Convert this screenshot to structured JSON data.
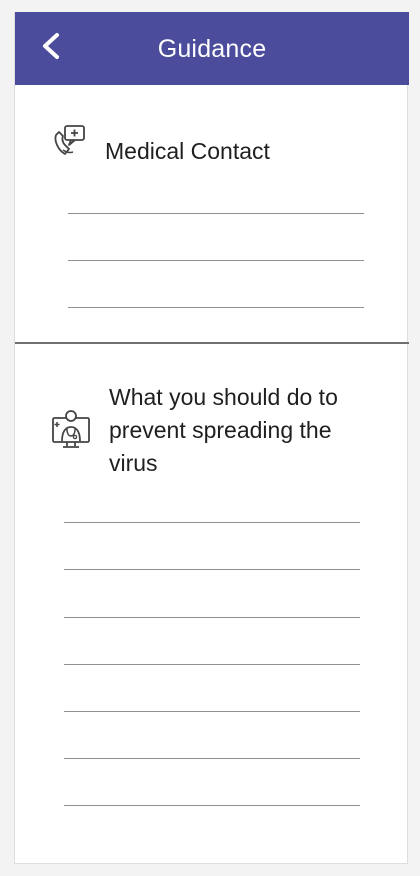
{
  "header": {
    "title": "Guidance",
    "background_color": "#4c4c9d",
    "back_icon": "chevron-left-icon"
  },
  "sections": [
    {
      "title": "Medical Contact",
      "icon": "phone-medical-icon",
      "entry_line_count": 3
    },
    {
      "title": "What you should do to prevent spreading the virus",
      "icon": "doctor-monitor-icon",
      "entry_line_count": 7
    }
  ]
}
